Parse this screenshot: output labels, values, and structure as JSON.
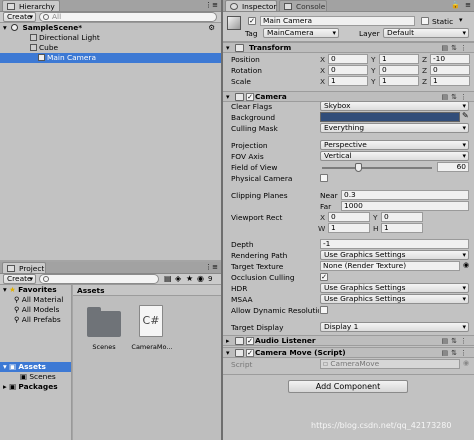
{
  "hierarchy": {
    "tab_label": "Hierarchy",
    "create_label": "Create",
    "search_placeholder": "All",
    "scene_name": "SampleScene*",
    "items": [
      {
        "label": "Directional Light"
      },
      {
        "label": "Cube"
      },
      {
        "label": "Main Camera"
      }
    ]
  },
  "project": {
    "tab_label": "Project",
    "console_tab_label": "Console",
    "create_label": "Create",
    "badge_count": "9",
    "favorites_label": "Favorites",
    "favorites": [
      "All Material",
      "All Models",
      "All Prefabs"
    ],
    "assets_label": "Assets",
    "assets_children": [
      "Scenes"
    ],
    "packages_label": "Packages",
    "breadcrumb": "Assets",
    "asset_items": [
      {
        "name": "Scenes",
        "icon": "folder-icon"
      },
      {
        "name": "CameraMo...",
        "icon": "csharp-script-icon",
        "glyph": "C#"
      }
    ]
  },
  "inspector": {
    "tab_label": "Inspector",
    "console_tab_label": "Console",
    "object_name": "Main Camera",
    "static_label": "Static",
    "tag_label": "Tag",
    "tag_value": "MainCamera",
    "layer_label": "Layer",
    "layer_value": "Default",
    "transform": {
      "title": "Transform",
      "rows": [
        {
          "label": "Position",
          "x": "0",
          "y": "1",
          "z": "-10"
        },
        {
          "label": "Rotation",
          "x": "0",
          "y": "0",
          "z": "0"
        },
        {
          "label": "Scale",
          "x": "1",
          "y": "1",
          "z": "1"
        }
      ],
      "axis_x": "X",
      "axis_y": "Y",
      "axis_z": "Z"
    },
    "camera": {
      "title": "Camera",
      "clear_flags_label": "Clear Flags",
      "clear_flags_value": "Skybox",
      "background_label": "Background",
      "background_color": "#314d79",
      "culling_mask_label": "Culling Mask",
      "culling_mask_value": "Everything",
      "projection_label": "Projection",
      "projection_value": "Perspective",
      "fov_axis_label": "FOV Axis",
      "fov_axis_value": "Vertical",
      "fov_label": "Field of View",
      "fov_value": "60",
      "fov_slider_fraction": 0.33,
      "physical_label": "Physical Camera",
      "clipping_label": "Clipping Planes",
      "near_label": "Near",
      "near_value": "0.3",
      "far_label": "Far",
      "far_value": "1000",
      "viewport_label": "Viewport Rect",
      "vp_x_label": "X",
      "vp_x": "0",
      "vp_y_label": "Y",
      "vp_y": "0",
      "vp_w_label": "W",
      "vp_w": "1",
      "vp_h_label": "H",
      "vp_h": "1",
      "depth_label": "Depth",
      "depth_value": "-1",
      "rendering_path_label": "Rendering Path",
      "rendering_path_value": "Use Graphics Settings",
      "target_texture_label": "Target Texture",
      "target_texture_value": "None (Render Texture)",
      "occlusion_label": "Occlusion Culling",
      "hdr_label": "HDR",
      "hdr_value": "Use Graphics Settings",
      "msaa_label": "MSAA",
      "msaa_value": "Use Graphics Settings",
      "dynres_label": "Allow Dynamic Resolutio",
      "target_display_label": "Target Display",
      "target_display_value": "Display 1"
    },
    "audio_listener": {
      "title": "Audio Listener"
    },
    "camera_move": {
      "title": "Camera Move (Script)",
      "script_label": "Script",
      "script_value": "CameraMove"
    },
    "add_component_label": "Add Component"
  },
  "watermark": "https://blog.csdn.net/qq_42173280"
}
